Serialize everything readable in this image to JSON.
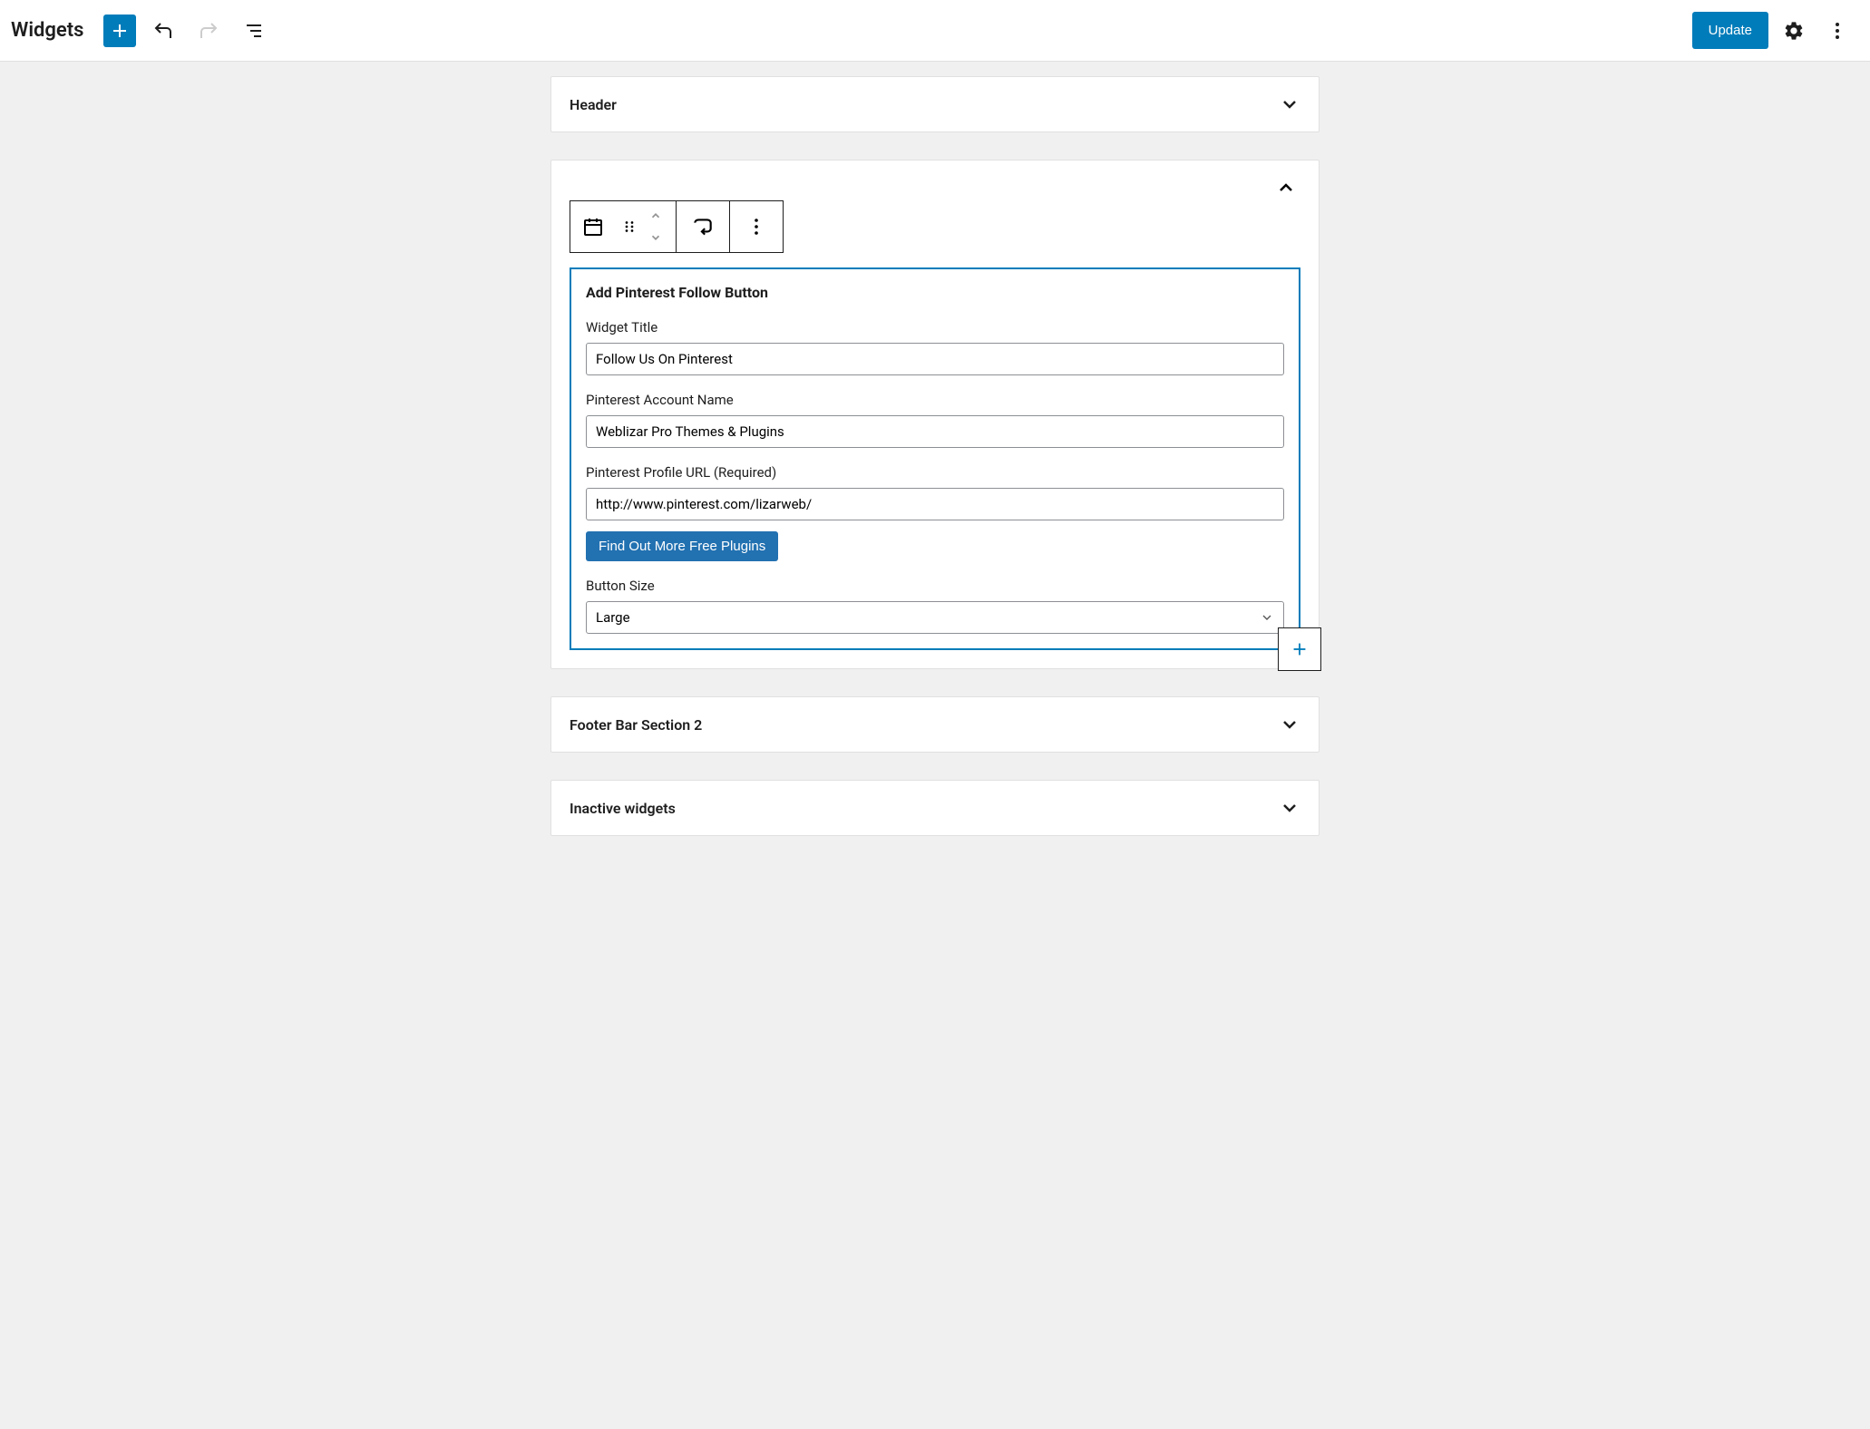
{
  "header": {
    "page_title": "Widgets",
    "update_label": "Update"
  },
  "areas": {
    "header_area": {
      "title": "Header"
    },
    "active_area": {
      "title": ""
    },
    "footer_2": {
      "title": "Footer Bar Section 2"
    },
    "inactive": {
      "title": "Inactive widgets"
    }
  },
  "widget": {
    "title": "Add Pinterest Follow Button",
    "fields": {
      "widget_title": {
        "label": "Widget Title",
        "value": "Follow Us On Pinterest"
      },
      "account_name": {
        "label": "Pinterest Account Name",
        "value": "Weblizar Pro Themes & Plugins"
      },
      "profile_url": {
        "label": "Pinterest Profile URL (Required)",
        "value": "http://www.pinterest.com/lizarweb/"
      },
      "button_size": {
        "label": "Button Size",
        "value": "Large"
      }
    },
    "plugin_link_label": "Find Out More Free Plugins"
  },
  "icons": {
    "add": "add-icon",
    "undo": "undo-icon",
    "redo": "redo-icon",
    "list_view": "list-view-icon",
    "settings": "gear-icon",
    "more": "more-vertical-icon"
  }
}
